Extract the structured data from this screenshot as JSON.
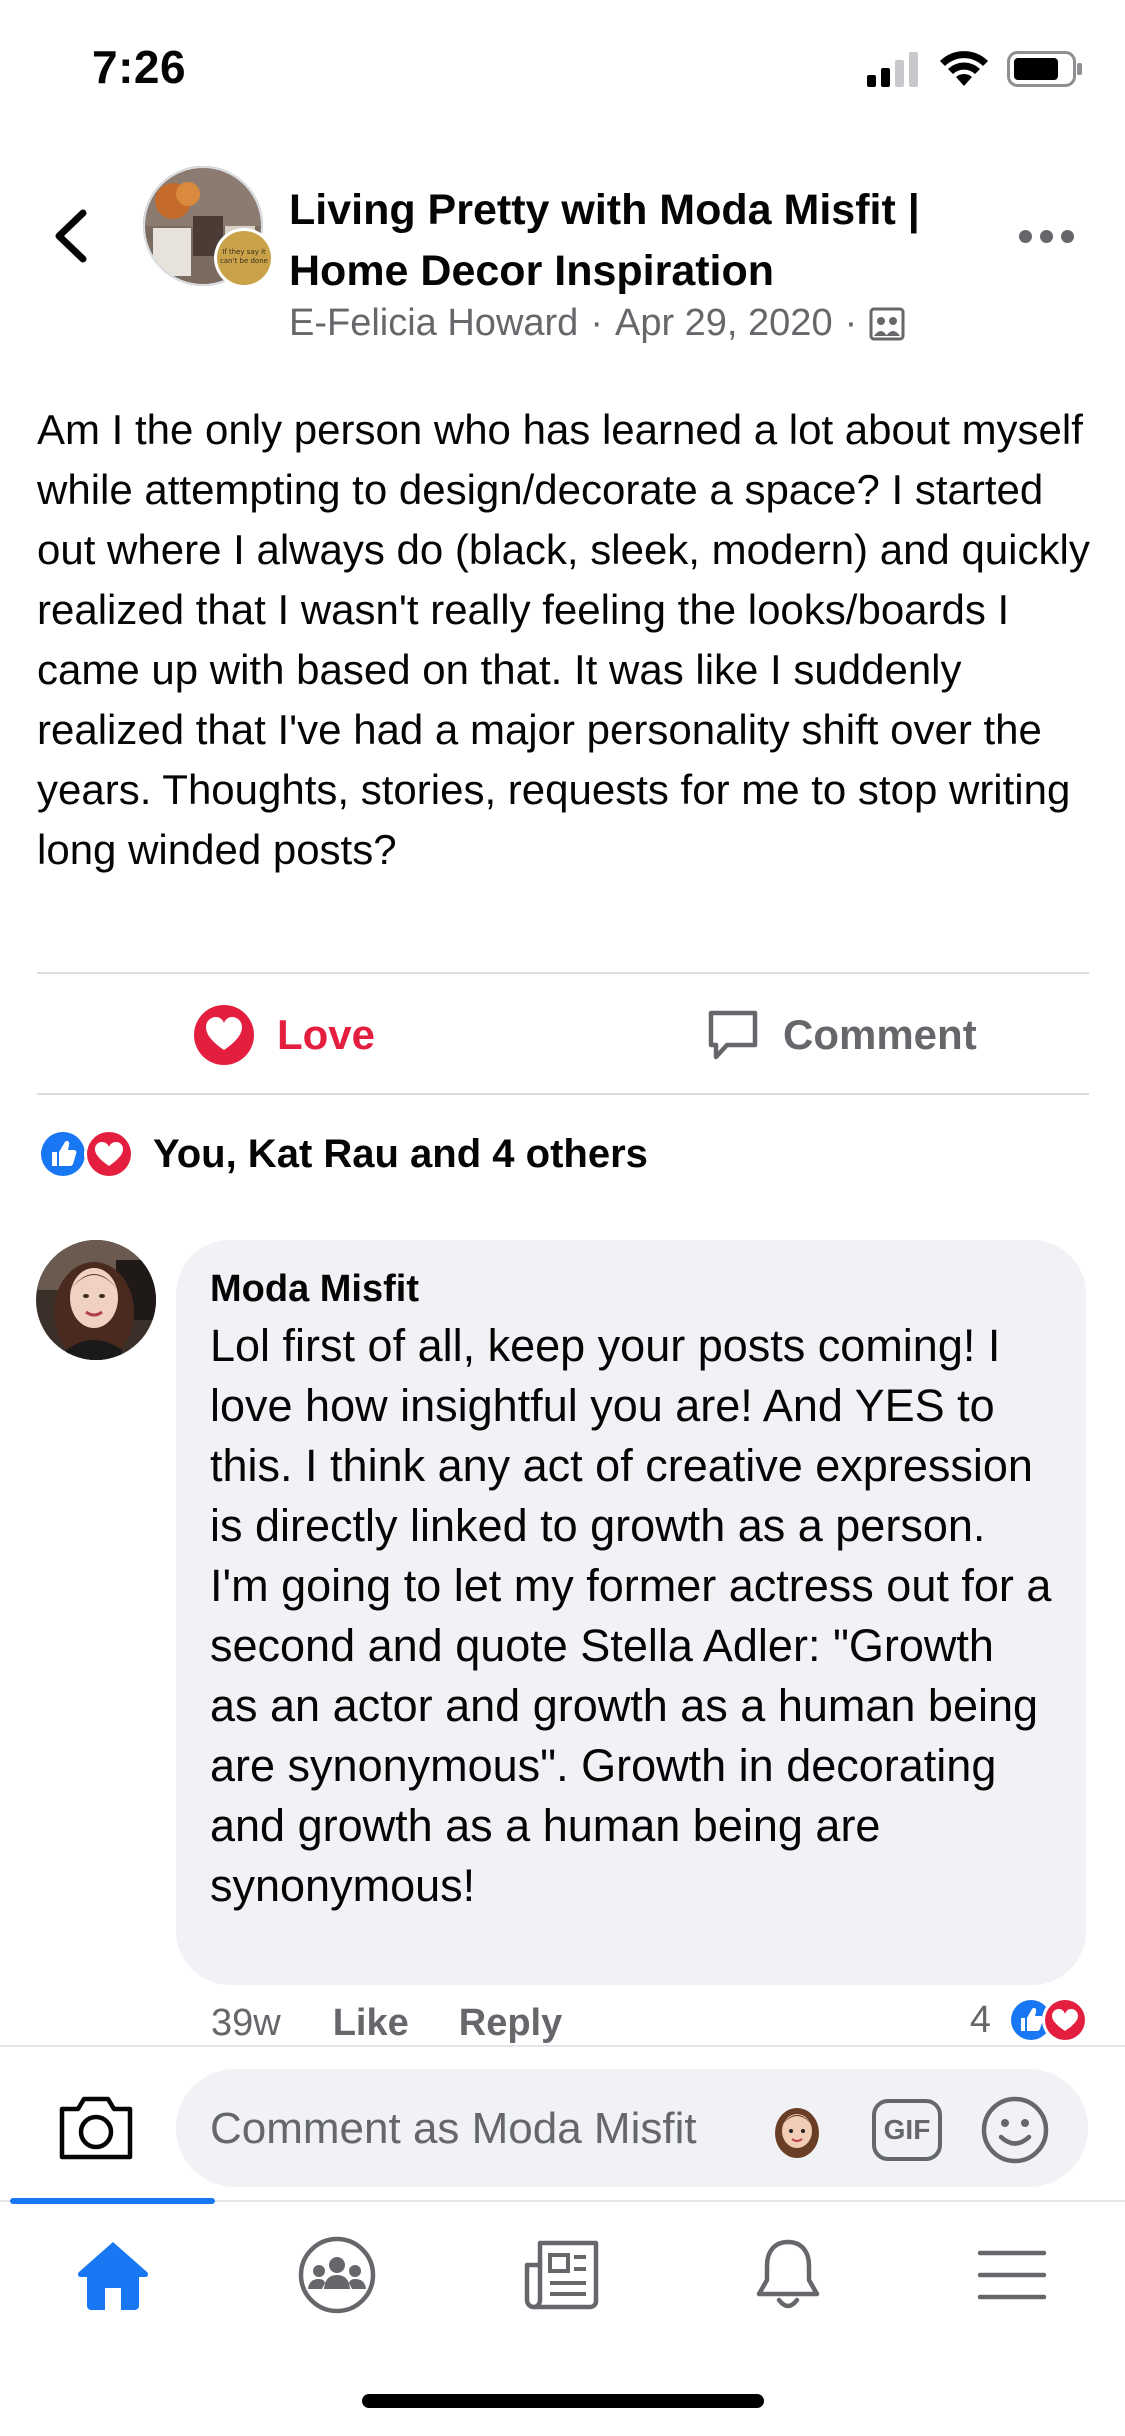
{
  "status_bar": {
    "time": "7:26"
  },
  "header": {
    "group_title": "Living Pretty with Moda Misfit | Home Decor Inspiration",
    "author": "E-Felicia Howard",
    "date": "Apr 29, 2020",
    "separator": "·",
    "icons": {
      "back": "chevron-left-icon",
      "more": "more-dots-icon",
      "audience": "group-audience-icon"
    }
  },
  "post": {
    "text": "Am I the only person who has learned a lot about myself while attempting to design/decorate a space? I started out where I always do (black, sleek, modern) and quickly realized that I wasn't really feeling the looks/boards I came up with based on that. It was like I suddenly realized that I've had a major personality shift over the years. Thoughts, stories, requests for me to stop writing long winded posts?"
  },
  "actions": {
    "love_label": "Love",
    "comment_label": "Comment"
  },
  "reactions": {
    "summary": "You, Kat Rau and 4 others",
    "types": [
      "like",
      "love"
    ]
  },
  "comment": {
    "author": "Moda Misfit",
    "text": "Lol first of all, keep your posts coming! I love how insightful you are! And YES to this. I think any act of creative expression is directly linked to growth as a person. I'm going to let my former actress out for a second and quote Stella Adler: \"Growth as an actor and growth as a human being are synonymous\". Growth in decorating and growth as a human being are synonymous!",
    "time": "39w",
    "like_label": "Like",
    "reply_label": "Reply",
    "reaction_count": "4"
  },
  "composer": {
    "placeholder": "Comment as Moda Misfit",
    "gif_label": "GIF"
  },
  "tabbar": {
    "tabs": [
      "home-icon",
      "groups-icon",
      "news-icon",
      "bell-icon",
      "menu-icon"
    ],
    "active": "home-icon"
  },
  "colors": {
    "accent": "#1877f2",
    "love": "#e41e3f",
    "secondary_text": "#65676b",
    "bubble": "#f0f2f5"
  }
}
